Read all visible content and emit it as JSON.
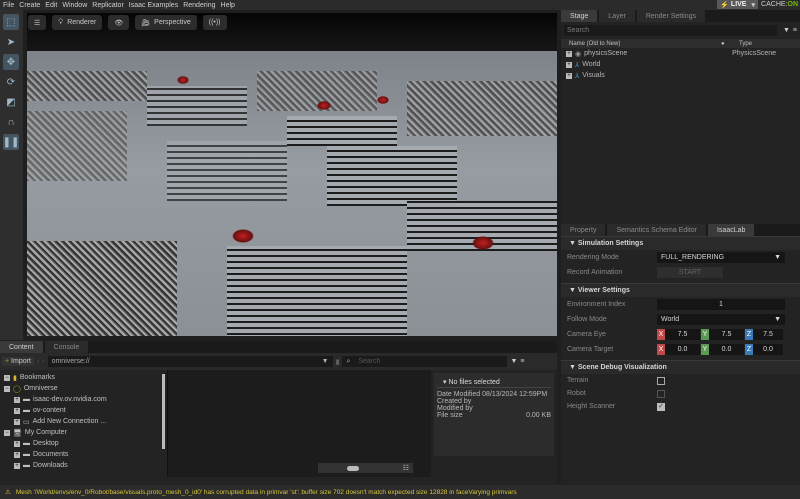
{
  "menu": [
    "File",
    "Create",
    "Edit",
    "Window",
    "Replicator",
    "Isaac Examples",
    "Rendering",
    "Help"
  ],
  "live": "LIVE",
  "cache_label": "CACHE:",
  "cache_state": "ON",
  "viewport": {
    "renderer": "Renderer",
    "camera": "Perspective"
  },
  "stage": {
    "tabs": [
      "Stage",
      "Layer",
      "Render Settings"
    ],
    "search_placeholder": "Search",
    "col_name": "Name (Old to New)",
    "col_type": "Type",
    "items": [
      {
        "name": "physicsScene",
        "type": "PhysicsScene"
      },
      {
        "name": "World",
        "type": ""
      },
      {
        "name": "Visuals",
        "type": ""
      }
    ]
  },
  "property": {
    "tabs": [
      "Property",
      "Semantics Schema Editor",
      "IsaacLab"
    ],
    "sim": {
      "title": "Simulation Settings",
      "rendering_mode_label": "Rendering Mode",
      "rendering_mode": "FULL_RENDERING",
      "record_label": "Record Animation",
      "record_button": "START"
    },
    "viewer": {
      "title": "Viewer Settings",
      "env_index_label": "Environment Index",
      "env_index": "1",
      "follow_label": "Follow Mode",
      "follow": "World",
      "eye_label": "Camera Eye",
      "eye": [
        "7.5",
        "7.5",
        "7.5"
      ],
      "target_label": "Camera Target",
      "target": [
        "0.0",
        "0.0",
        "0.0"
      ],
      "axes": [
        "X",
        "Y",
        "Z"
      ]
    },
    "debug": {
      "title": "Scene Debug Visualization",
      "terrain": "Terrain",
      "robot": "Robot",
      "height_scanner": "Height Scanner",
      "height_scanner_checked": true
    }
  },
  "content": {
    "tabs": [
      "Content",
      "Console"
    ],
    "import": "Import",
    "path": "omniverse://",
    "search_placeholder": "Search",
    "tree": [
      "Bookmarks",
      "Omniverse",
      "isaac-dev.ov.nvidia.com",
      "ov-content",
      "Add New Connection ...",
      "My Computer",
      "Desktop",
      "Documents",
      "Downloads"
    ],
    "info": {
      "title": "No files selected",
      "date_label": "Date Modified",
      "date": "08/13/2024 12:59PM",
      "created": "Created by",
      "modified": "Modified by",
      "size_label": "File size",
      "size": "0.00 KB"
    }
  },
  "status": "Mesh '/World/envs/env_0/Robot/base/visuals.proto_mesh_0_id0' has corrupted data in primvar 'st': buffer size 702 doesn't match expected size 12828 in faceVarying primvars"
}
